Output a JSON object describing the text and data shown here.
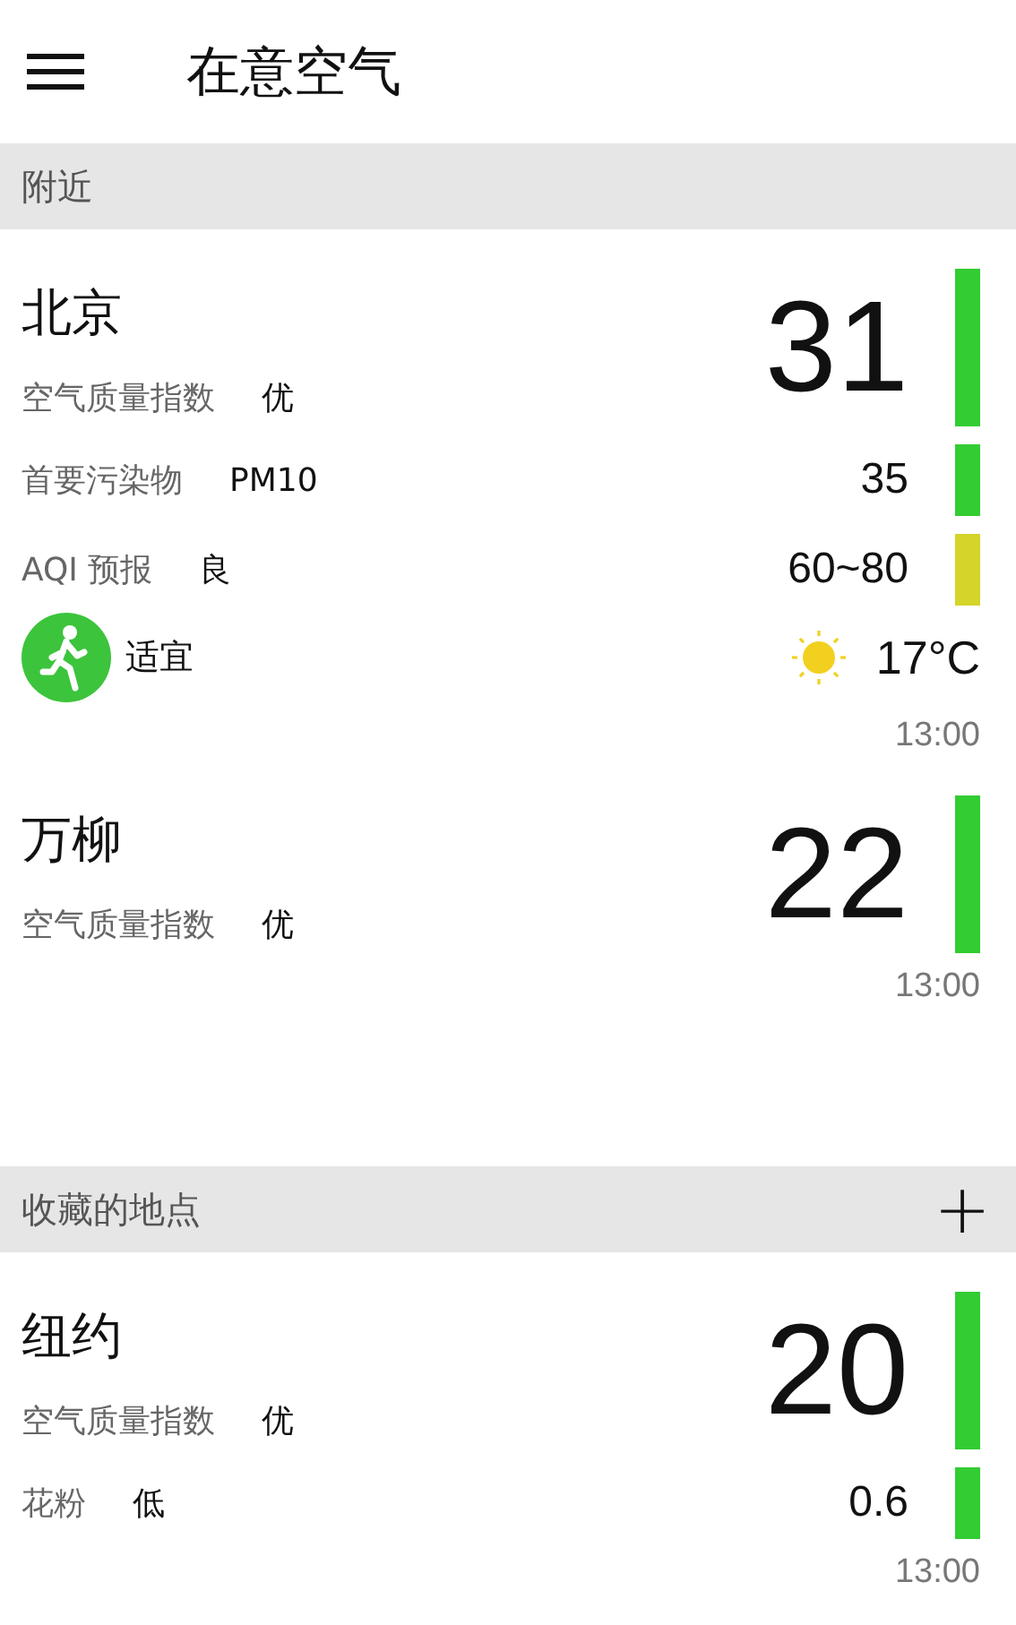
{
  "app_bar": {
    "title": "在意空气"
  },
  "sections": [
    {
      "title": "附近",
      "cards": [
        {
          "name": "北京",
          "aqi_label": "空气质量指数",
          "aqi_level": "优",
          "aqi": "31",
          "color": "#33cc33",
          "rows": [
            {
              "label": "首要污染物",
              "value": "PM10",
              "reading": "35",
              "color": "#33cc33"
            },
            {
              "label": "AQI 预报",
              "value": "良",
              "reading": "60~80",
              "color": "#d4d42a"
            }
          ],
          "activity": {
            "text": "适宜"
          },
          "weather": {
            "temp": "17°C"
          },
          "time": "13:00"
        },
        {
          "name": "万柳",
          "aqi_label": "空气质量指数",
          "aqi_level": "优",
          "aqi": "22",
          "color": "#33cc33",
          "time": "13:00"
        }
      ]
    },
    {
      "title": "收藏的地点",
      "action": "+",
      "cards": [
        {
          "name": "纽约",
          "aqi_label": "空气质量指数",
          "aqi_level": "优",
          "aqi": "20",
          "color": "#33cc33",
          "rows": [
            {
              "label": "花粉",
              "value": "低",
              "reading": "0.6",
              "color": "#33cc33"
            }
          ],
          "time": "13:00"
        }
      ]
    }
  ]
}
